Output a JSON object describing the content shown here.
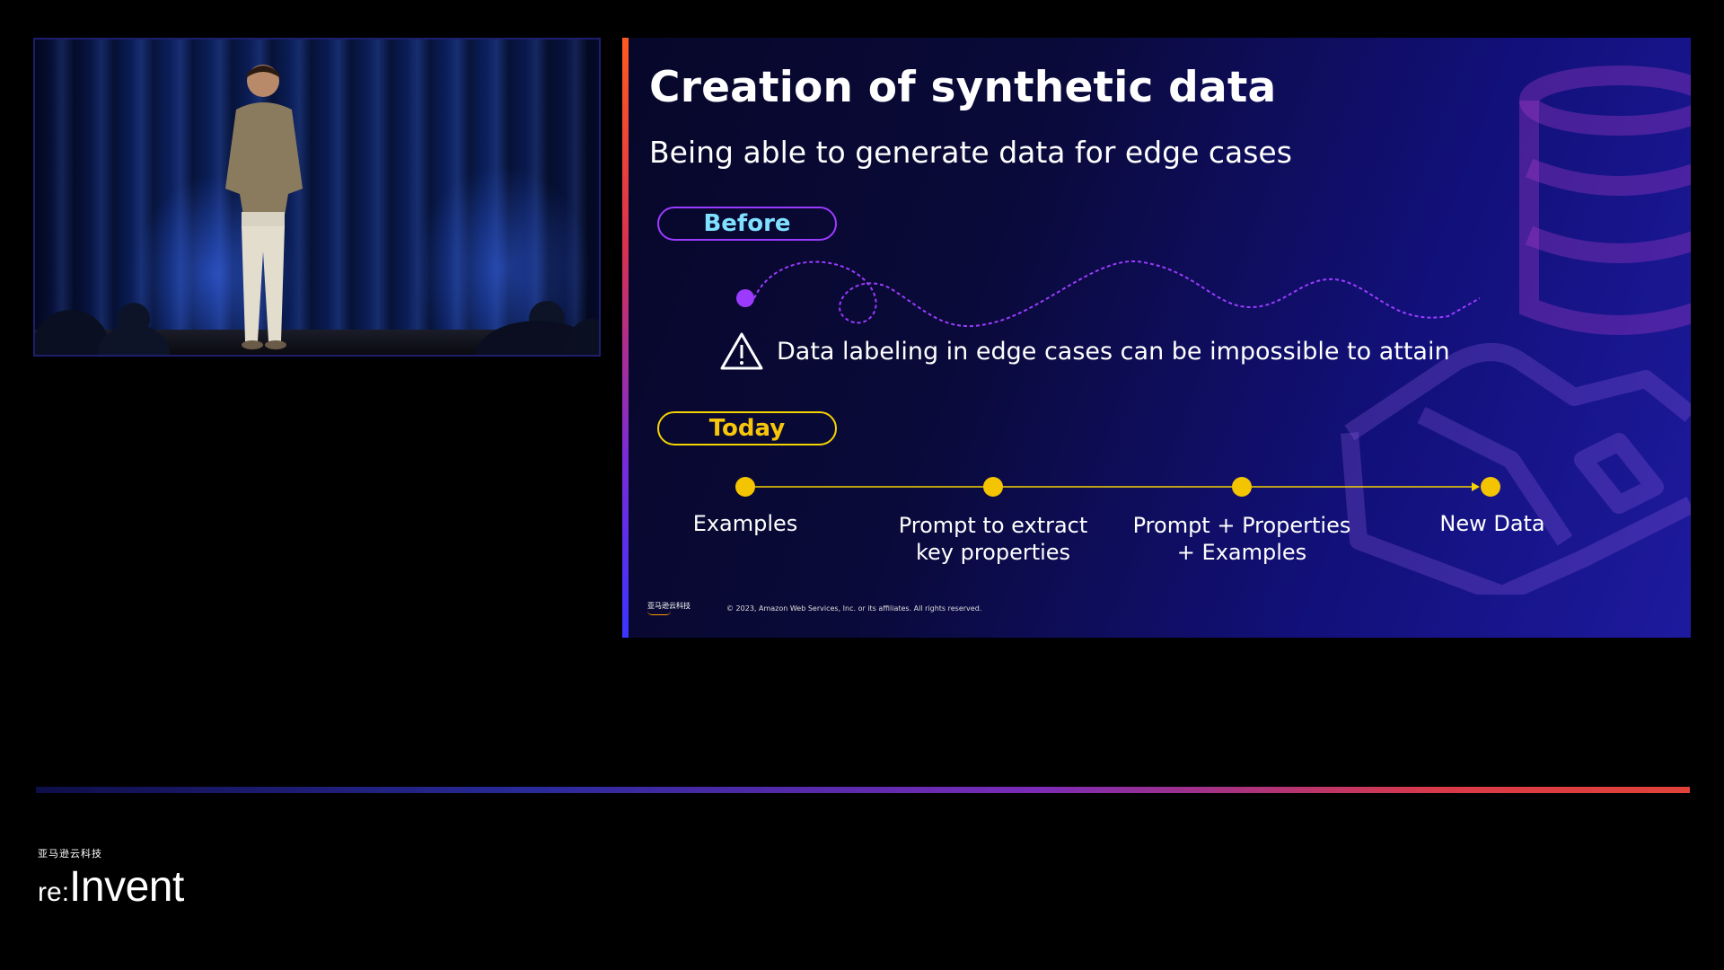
{
  "slide": {
    "title": "Creation of synthetic data",
    "subtitle": "Being able to generate data for edge cases",
    "before_label": "Before",
    "today_label": "Today",
    "warning_text": "Data labeling in edge cases can be impossible to attain",
    "timeline": [
      {
        "line1": "Examples",
        "line2": ""
      },
      {
        "line1": "Prompt to extract",
        "line2": "key properties"
      },
      {
        "line1": "Prompt + Properties",
        "line2": "+ Examples"
      },
      {
        "line1": "New Data",
        "line2": ""
      }
    ],
    "footer_logo_text": "亚马逊云科技",
    "copyright": "© 2023, Amazon Web Services, Inc. or its affiliates. All rights reserved."
  },
  "branding": {
    "cn_text": "亚马逊云科技",
    "re": "re",
    "colon": ":",
    "invent": "Invent"
  },
  "colors": {
    "before_accent": "#9b3bff",
    "before_text": "#7fe0ff",
    "today_accent": "#f5d400",
    "today_text": "#f7c60a",
    "wave": "#9b3bff"
  },
  "icons": [
    "warning-icon",
    "database-icon",
    "hand-icon"
  ]
}
